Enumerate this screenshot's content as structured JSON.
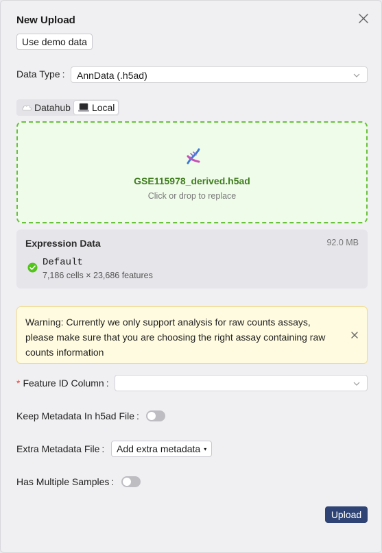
{
  "dialog": {
    "title": "New Upload",
    "demo_button": "Use demo data",
    "upload_button": "Upload"
  },
  "data_type": {
    "label": "Data Type",
    "colon": ":",
    "value": "AnnData (.h5ad)"
  },
  "source_tabs": [
    {
      "label": "Datahub",
      "icon": "cloud-icon",
      "active": false
    },
    {
      "label": "Local",
      "icon": "laptop-icon",
      "active": true
    }
  ],
  "dropzone": {
    "icon": "dna-icon",
    "file_name": "GSE115978_derived.h5ad",
    "hint": "Click or drop to replace"
  },
  "expression": {
    "title": "Expression Data",
    "size": "92.0 MB",
    "assay_name": "Default",
    "assay_meta": "7,186 cells × 23,686 features"
  },
  "warning": {
    "text": "Warning: Currently we only support analysis for raw counts assays, please make sure that you are choosing the right assay containing raw counts information"
  },
  "feature_id": {
    "required_mark": "*",
    "label": "Feature ID Column",
    "colon": ":",
    "value": ""
  },
  "keep_metadata": {
    "label": "Keep Metadata In h5ad File",
    "colon": ":",
    "enabled": false
  },
  "extra_metadata": {
    "label": "Extra Metadata File",
    "colon": ":",
    "button": "Add extra metadata",
    "caret": "▾"
  },
  "multiple_samples": {
    "label": "Has Multiple Samples",
    "colon": ":",
    "enabled": false
  },
  "colors": {
    "success": "#67c23a",
    "primary": "#2f4474",
    "warning_bg": "#fffbe0"
  }
}
